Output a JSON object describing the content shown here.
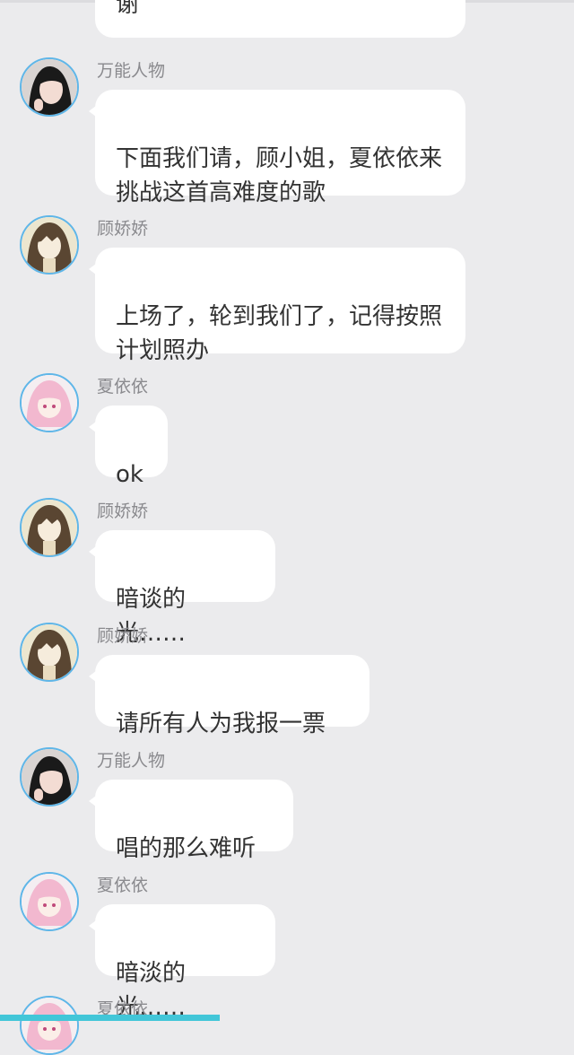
{
  "chat": {
    "top_partial_message": "谢",
    "messages": [
      {
        "sender": "万能人物",
        "text": "下面我们请，顾小姐，夏依依来挑战这首高难度的歌",
        "avatar": "photo-girl-avatar"
      },
      {
        "sender": "顾娇娇",
        "text": "上场了，轮到我们了，记得按照计划照办",
        "avatar": "anime-brown-hair-avatar"
      },
      {
        "sender": "夏依依",
        "text": "ok",
        "avatar": "anime-pink-hair-avatar"
      },
      {
        "sender": "顾娇娇",
        "text": "暗谈的光……",
        "avatar": "anime-brown-hair-avatar"
      },
      {
        "sender": "顾娇娇",
        "text": "请所有人为我报一票",
        "avatar": "anime-brown-hair-avatar"
      },
      {
        "sender": "万能人物",
        "text": "唱的那么难听",
        "avatar": "photo-girl-avatar"
      },
      {
        "sender": "夏依依",
        "text": "暗淡的光……",
        "avatar": "anime-pink-hair-avatar"
      },
      {
        "sender": "夏依依",
        "text": "",
        "avatar": "anime-pink-hair-avatar"
      }
    ]
  },
  "colors": {
    "background": "#ebebed",
    "bubble": "#ffffff",
    "avatar_ring": "#5fb6e8",
    "bottom_bar": "#42c6d8"
  }
}
